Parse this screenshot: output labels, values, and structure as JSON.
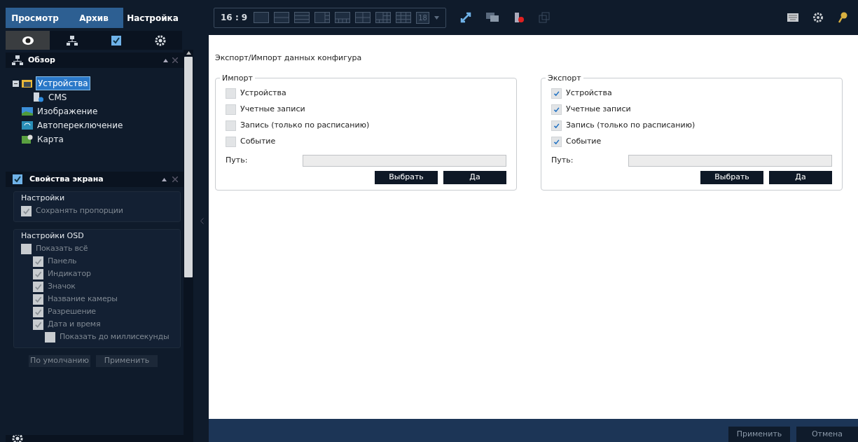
{
  "top_tabs": [
    {
      "label": "Просмотр",
      "selected": false
    },
    {
      "label": "Архив",
      "selected": false
    },
    {
      "label": "Настройка",
      "selected": true
    }
  ],
  "view_tabs": [
    {
      "kind": "eye",
      "selected": true
    },
    {
      "kind": "network",
      "selected": false
    },
    {
      "kind": "check",
      "selected": false
    },
    {
      "kind": "gear",
      "selected": false
    }
  ],
  "overview": {
    "title": "Обзор",
    "tree": [
      {
        "label": "Устройства",
        "kind": "folder",
        "selected": true,
        "expanded": true,
        "children": [
          {
            "label": "CMS",
            "kind": "server",
            "selected": false
          }
        ]
      },
      {
        "label": "Изображение",
        "kind": "image",
        "selected": false
      },
      {
        "label": "Автопереключение",
        "kind": "switch",
        "selected": false
      },
      {
        "label": "Карта",
        "kind": "map",
        "selected": false
      }
    ]
  },
  "screen_properties": {
    "title": "Свойства экрана",
    "groups": [
      {
        "title": "Настройки",
        "items": [
          {
            "label": "Сохранять пропорции",
            "checked": true,
            "disabled": true
          }
        ]
      },
      {
        "title": "Настройки OSD",
        "items": [
          {
            "label": "Показать всё",
            "checked": false,
            "disabled": true,
            "children": [
              {
                "label": "Панель",
                "checked": true,
                "disabled": true
              },
              {
                "label": "Индикатор",
                "checked": true,
                "disabled": true
              },
              {
                "label": "Значок",
                "checked": true,
                "disabled": true
              },
              {
                "label": "Название камеры",
                "checked": true,
                "disabled": true
              },
              {
                "label": "Разрешение",
                "checked": true,
                "disabled": true
              },
              {
                "label": "Дата и время",
                "checked": true,
                "disabled": true,
                "children": [
                  {
                    "label": "Показать до миллисекунды",
                    "checked": false,
                    "disabled": true
                  }
                ]
              }
            ]
          }
        ]
      }
    ],
    "buttons": [
      "По умолчанию",
      "Применить"
    ]
  },
  "toolbar": {
    "aspect": "16 : 9",
    "layouts": [
      {
        "kind": "single"
      },
      {
        "kind": "two_rows"
      },
      {
        "kind": "three_rows"
      },
      {
        "kind": "one_plus_three"
      },
      {
        "kind": "one_plus_four"
      },
      {
        "kind": "quad"
      },
      {
        "kind": "one_plus_six"
      },
      {
        "kind": "nine"
      }
    ],
    "count": "18"
  },
  "page_title": "Экспорт/Импорт данных конфигура",
  "sections": [
    {
      "title": "Импорт",
      "items": [
        {
          "label": "Устройства",
          "checked": false
        },
        {
          "label": "Учетные записи",
          "checked": false
        },
        {
          "label": "Запись (только по расписанию)",
          "checked": false
        },
        {
          "label": "Событие",
          "checked": false
        }
      ],
      "path_label": "Путь:",
      "buttons": [
        "Выбрать",
        "Да"
      ]
    },
    {
      "title": "Экспорт",
      "items": [
        {
          "label": "Устройства",
          "checked": true
        },
        {
          "label": "Учетные записи",
          "checked": true
        },
        {
          "label": "Запись (только по расписанию)",
          "checked": true
        },
        {
          "label": "Событие",
          "checked": true
        }
      ],
      "path_label": "Путь:",
      "buttons": [
        "Выбрать",
        "Да"
      ]
    }
  ],
  "footer_buttons": [
    "Применить",
    "Отмена"
  ]
}
